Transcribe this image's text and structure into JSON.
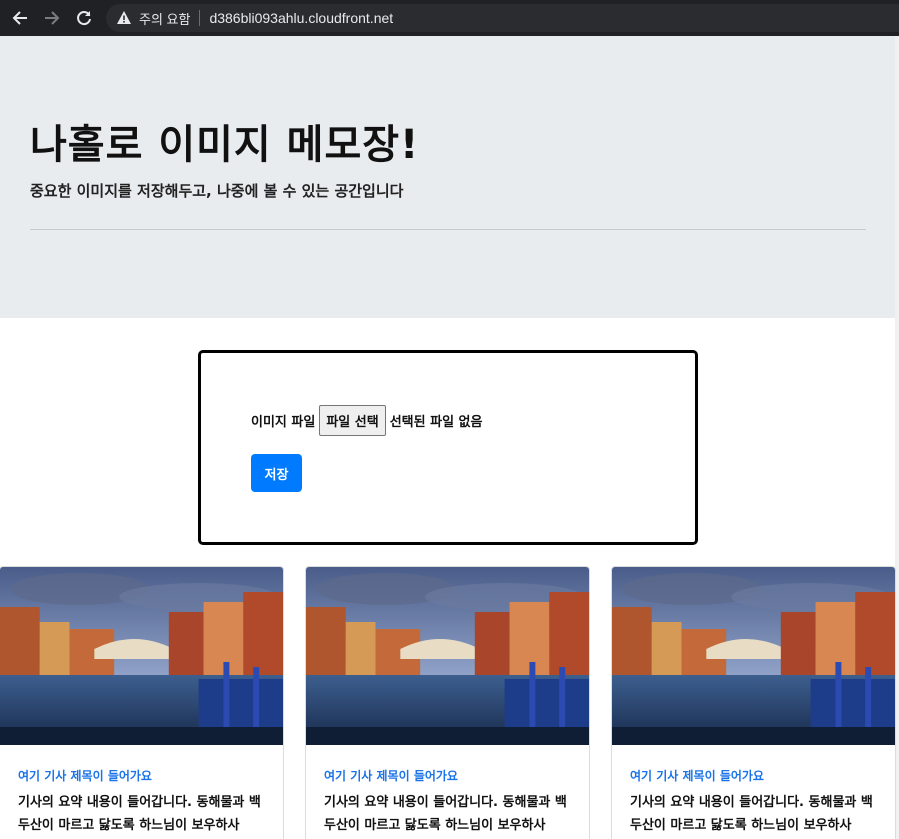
{
  "browser": {
    "security_label": "주의 요함",
    "url": "d386bli093ahlu.cloudfront.net",
    "icons": [
      "back-arrow-icon",
      "forward-arrow-icon",
      "reload-icon",
      "warning-icon"
    ]
  },
  "header": {
    "title": "나홀로 이미지 메모장!",
    "lead": "중요한 이미지를 저장해두고, 나중에 볼 수 있는 공간입니다"
  },
  "upload": {
    "label": "이미지 파일",
    "choose_button": "파일 선택",
    "status": "선택된 파일 없음",
    "save_label": "저장"
  },
  "colors": {
    "primary": "#007bff",
    "link": "#1a73e8",
    "jumbotron_bg": "#e9ecef",
    "browser_bar": "#202124"
  },
  "cards": [
    {
      "title": "여기 기사 제목이 들어가요",
      "text": "기사의 요약 내용이 들어갑니다. 동해물과 백두산이 마르고 닳도록 하느님이 보우하사"
    },
    {
      "title": "여기 기사 제목이 들어가요",
      "text": "기사의 요약 내용이 들어갑니다. 동해물과 백두산이 마르고 닳도록 하느님이 보우하사"
    },
    {
      "title": "여기 기사 제목이 들어가요",
      "text": "기사의 요약 내용이 들어갑니다. 동해물과 백두산이 마르고 닳도록 하느님이 보우하사"
    }
  ]
}
